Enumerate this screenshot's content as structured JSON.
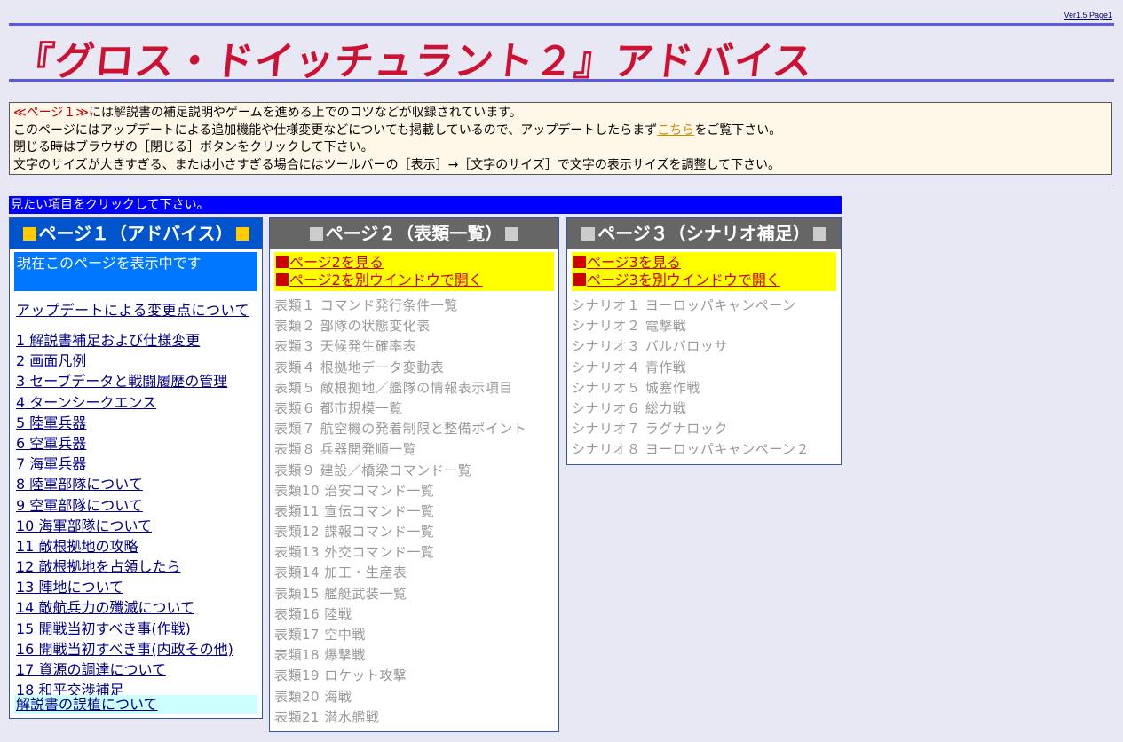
{
  "version_label": "Ver1.5  Page1",
  "title": "『グロス・ドイッチュラント２』アドバイス",
  "info": {
    "line1_red": "≪ページ１≫",
    "line1_rest": "には解説書の補足説明やゲームを進める上でのコツなどが収録されています。",
    "line2_pre": "このページにはアップデートによる追加機能や仕様変更などについても掲載しているので、アップデートしたらまず",
    "line2_link": "こちら",
    "line2_post": "をご覧下さい。",
    "line3": "閉じる時はブラウザの［閉じる］ボタンをクリックして下さい。",
    "line4": "文字のサイズが大きすぎる、または小さすぎる場合にはツールバーの［表示］→［文字のサイズ］で文字の表示サイズを調整して下さい。"
  },
  "instruction": "見たい項目をクリックして下さい。",
  "page1": {
    "header": "ページ１（アドバイス）",
    "current": "現在このページを表示中です",
    "update_link": "アップデートによる変更点について",
    "items": [
      "1  解説書補足および仕様変更",
      "2  画面凡例",
      "3  セーブデータと戦闘履歴の管理",
      "4  ターンシークエンス",
      "5  陸軍兵器",
      "6  空軍兵器",
      "7  海軍兵器",
      "8  陸軍部隊について",
      "9  空軍部隊について",
      "10  海軍部隊について",
      "11  敵根拠地の攻略",
      "12  敵根拠地を占領したら",
      "13  陣地について",
      "14  敵航兵力の殲滅について",
      "15  開戦当初すべき事(作戦)",
      "16  開戦当初すべき事(内政その他)",
      "17  資源の調達について",
      "18  和平交渉補足"
    ],
    "errata": "解説書の誤植について"
  },
  "page2": {
    "header": "ページ２（表類一覧）",
    "link_view": "ページ2を見る",
    "link_window": "ページ2を別ウインドウで開く",
    "items": [
      "表類１  コマンド発行条件一覧",
      "表類２  部隊の状態変化表",
      "表類３  天候発生確率表",
      "表類４  根拠地データ変動表",
      "表類５  敵根拠地／艦隊の情報表示項目",
      "表類６  都市規模一覧",
      "表類７  航空機の発着制限と整備ポイント",
      "表類８  兵器開発順一覧",
      "表類９  建設／橋梁コマンド一覧",
      "表類10  治安コマンド一覧",
      "表類11  宣伝コマンド一覧",
      "表類12  諜報コマンド一覧",
      "表類13  外交コマンド一覧",
      "表類14  加工・生産表",
      "表類15  艦艇武装一覧",
      "表類16  陸戦",
      "表類17  空中戦",
      "表類18  爆撃戦",
      "表類19  ロケット攻撃",
      "表類20  海戦",
      "表類21  潜水艦戦"
    ]
  },
  "page3": {
    "header": "ページ３（シナリオ補足）",
    "link_view": "ページ3を見る",
    "link_window": "ページ3を別ウインドウで開く",
    "items": [
      "シナリオ１  ヨーロッパキャンペーン",
      "シナリオ２  電撃戦",
      "シナリオ３  バルバロッサ",
      "シナリオ４  青作戦",
      "シナリオ５  城塞作戦",
      "シナリオ６  総力戦",
      "シナリオ７  ラグナロック",
      "シナリオ８  ヨーロッパキャンペーン２"
    ]
  },
  "colors": {
    "title_red": "#cc1133",
    "rule_blue": "#5a5ae0",
    "instruction_bar": "#0000ff",
    "page1_header": "#0055cc",
    "inactive_header": "#666666",
    "link_navy": "#000088",
    "yellow_box": "#ffff00"
  }
}
